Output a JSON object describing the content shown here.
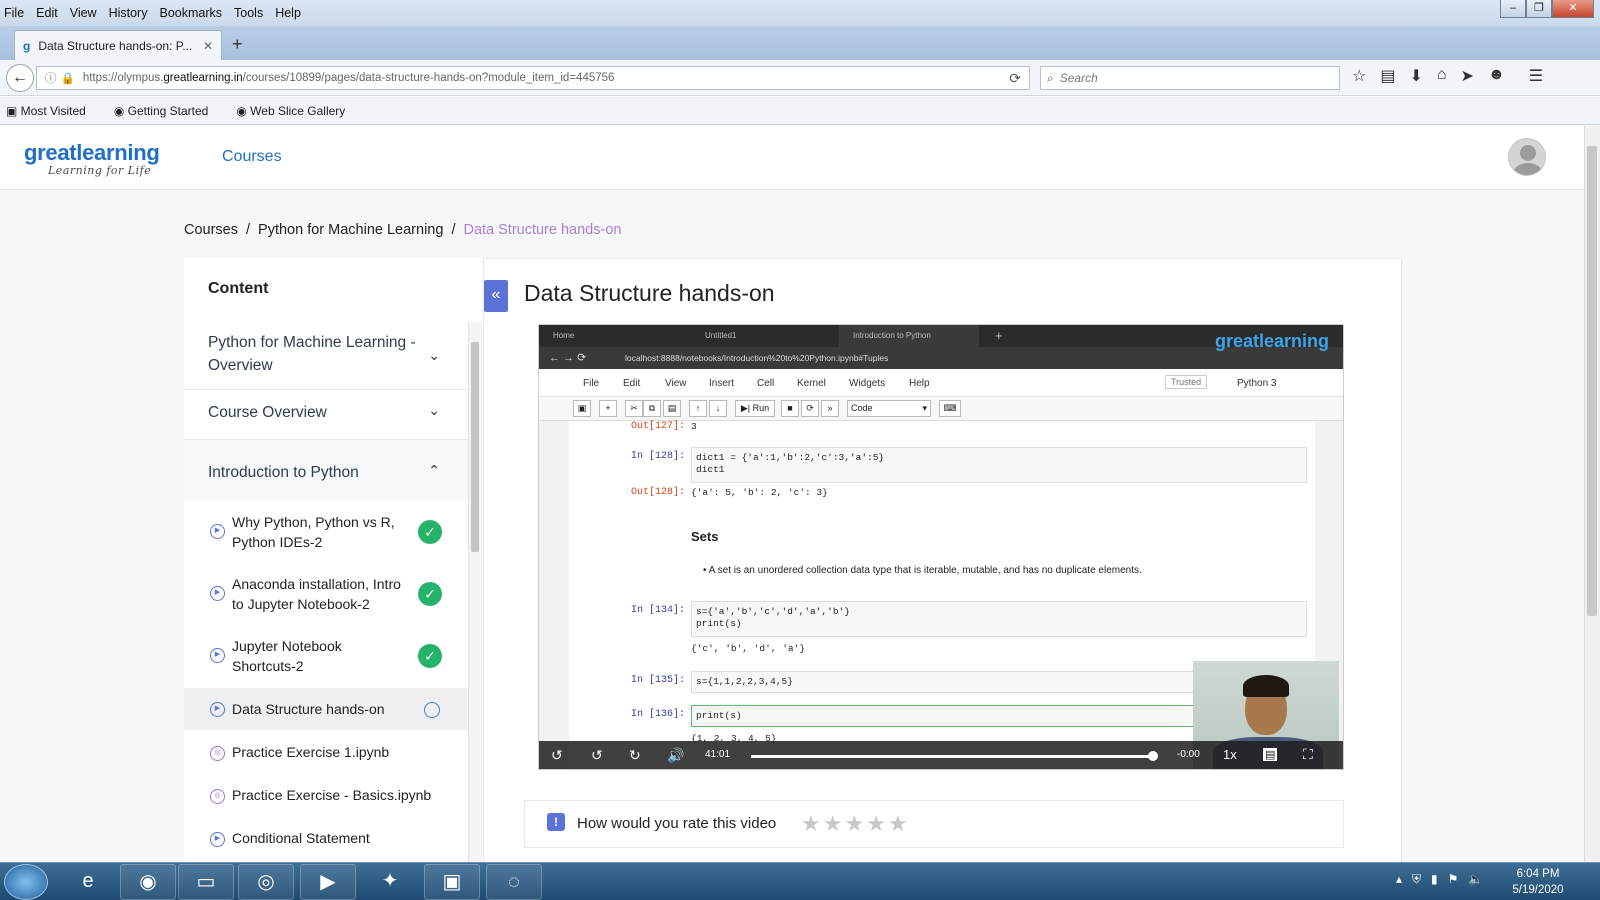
{
  "browser": {
    "menu": [
      "File",
      "Edit",
      "View",
      "History",
      "Bookmarks",
      "Tools",
      "Help"
    ],
    "tab_title": "Data Structure hands-on: P...",
    "url_prefix": "https://olympus.",
    "url_domain": "greatlearning.in",
    "url_rest": "/courses/10899/pages/data-structure-hands-on?module_item_id=445756",
    "search_placeholder": "Search",
    "bookmarks": [
      "Most Visited",
      "Getting Started",
      "Web Slice Gallery"
    ]
  },
  "site": {
    "logo": "greatlearning",
    "tagline": "Learning for Life",
    "nav_courses": "Courses"
  },
  "breadcrumb": [
    "Courses",
    "Python for Machine Learning",
    "Data Structure hands-on"
  ],
  "sidebar": {
    "title": "Content",
    "sections": [
      "Python for Machine Learning - Overview",
      "Course Overview",
      "Introduction to Python"
    ],
    "items": [
      {
        "label": "Why Python, Python vs R, Python IDEs-2",
        "status": "complete"
      },
      {
        "label": "Anaconda installation, Intro to Jupyter Notebook-2",
        "status": "complete"
      },
      {
        "label": "Jupyter Notebook Shortcuts-2",
        "status": "complete"
      },
      {
        "label": "Data Structure hands-on",
        "status": "current"
      },
      {
        "label": "Practice Exercise 1.ipynb",
        "status": "notebook"
      },
      {
        "label": "Practice Exercise - Basics.ipynb",
        "status": "notebook"
      },
      {
        "label": "Conditional Statement",
        "status": "video"
      }
    ]
  },
  "main": {
    "title": "Data Structure hands-on"
  },
  "video": {
    "tabs": [
      "Home",
      "Untitled1",
      "Introduction to Python"
    ],
    "address": "localhost:8888/notebooks/Introduction%20to%20Python.ipynb#Tuples",
    "logo": "greatlearning",
    "menu": [
      "File",
      "Edit",
      "View",
      "Insert",
      "Cell",
      "Kernel",
      "Widgets",
      "Help"
    ],
    "trusted": "Trusted",
    "kernel": "Python 3",
    "run_label": "Run",
    "cell_type": "Code",
    "cells": {
      "out127_prompt": "Out[127]:",
      "out127": "3",
      "in128_prompt": "In [128]:",
      "in128_l1": "dict1 = {'a':1,'b':2,'c':3,'a':5}",
      "in128_l2": "dict1",
      "out128_prompt": "Out[128]:",
      "out128": "{'a': 5, 'b': 2, 'c': 3}",
      "sets_heading": "Sets",
      "sets_bullet": "A set is an unordered collection data type that is iterable, mutable, and has no duplicate elements.",
      "in134_prompt": "In [134]:",
      "in134_l1": "s={'a','b','c','d','a','b'}",
      "in134_l2": "print(s)",
      "out134": "{'c', 'b', 'd', 'a'}",
      "in135_prompt": "In [135]:",
      "in135": "s={1,1,2,2,3,4,5}",
      "in136_prompt": "In [136]:",
      "in136": "print(s)",
      "out136": "{1, 2, 3, 4, 5}"
    },
    "time_elapsed": "41:01",
    "time_remaining": "-0:00",
    "speed": "1x",
    "progress": 0.99
  },
  "rating": {
    "prompt": "How would you rate this video",
    "stars": 5
  },
  "taskbar": {
    "time": "6:04 PM",
    "date": "5/19/2020"
  }
}
